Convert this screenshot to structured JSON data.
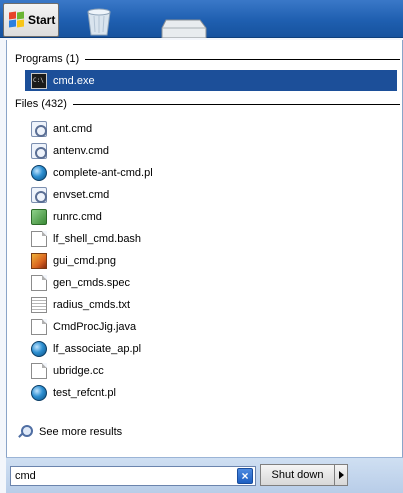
{
  "taskbar": {
    "start_label": "Start"
  },
  "programs": {
    "header": "Programs (1)",
    "items": [
      {
        "name": "cmd.exe",
        "icon": "console-icon",
        "selected": true
      }
    ]
  },
  "files": {
    "header": "Files (432)",
    "items": [
      {
        "name": "ant.cmd",
        "icon": "gear-script-icon"
      },
      {
        "name": "antenv.cmd",
        "icon": "gear-script-icon"
      },
      {
        "name": "complete-ant-cmd.pl",
        "icon": "perl-script-icon"
      },
      {
        "name": "envset.cmd",
        "icon": "gear-script-icon"
      },
      {
        "name": "runrc.cmd",
        "icon": "batch-file-icon"
      },
      {
        "name": "lf_shell_cmd.bash",
        "icon": "blank-document-icon"
      },
      {
        "name": "gui_cmd.png",
        "icon": "image-file-icon"
      },
      {
        "name": "gen_cmds.spec",
        "icon": "blank-document-icon"
      },
      {
        "name": "radius_cmds.txt",
        "icon": "text-document-icon"
      },
      {
        "name": "CmdProcJig.java",
        "icon": "blank-document-icon"
      },
      {
        "name": "lf_associate_ap.pl",
        "icon": "perl-script-icon"
      },
      {
        "name": "ubridge.cc",
        "icon": "blank-document-icon"
      },
      {
        "name": "test_refcnt.pl",
        "icon": "perl-script-icon"
      }
    ]
  },
  "see_more_label": "See more results",
  "search": {
    "value": "cmd"
  },
  "shutdown_label": "Shut down",
  "colors": {
    "selection": "#1c4f99",
    "taskbar": "#1f5fb0"
  }
}
